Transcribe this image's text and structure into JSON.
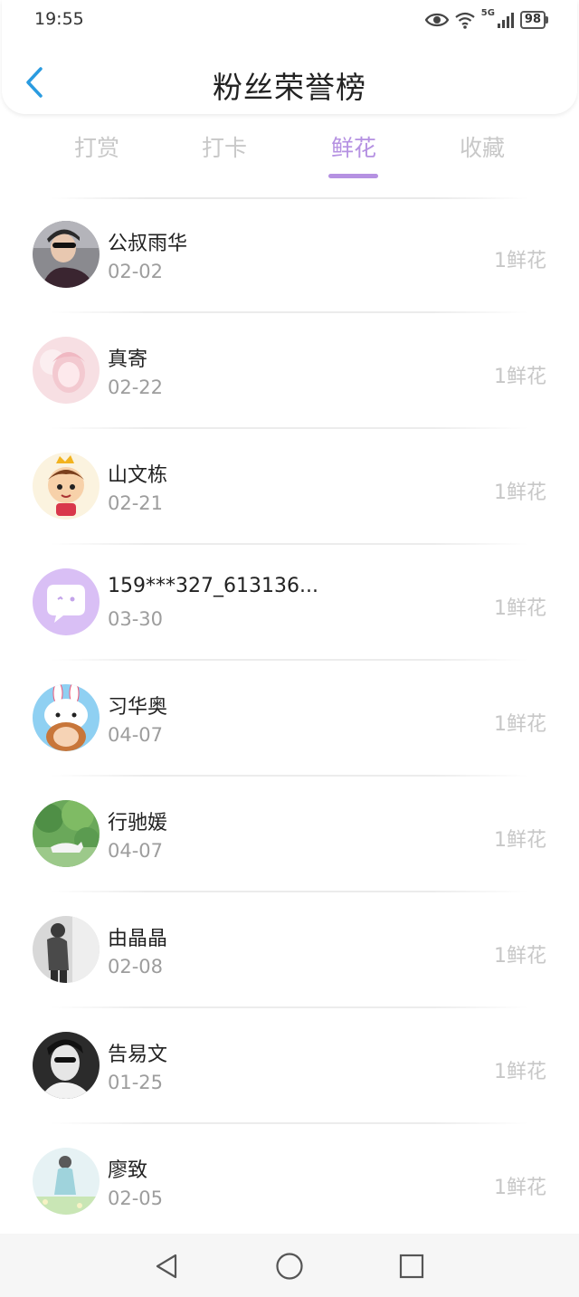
{
  "status_bar": {
    "time": "19:55",
    "network": "5G",
    "battery": "98",
    "icons": [
      "eye-icon",
      "wifi-icon",
      "signal-icon",
      "battery-icon"
    ]
  },
  "header": {
    "title": "粉丝荣誉榜",
    "back_icon": "chevron-left-icon"
  },
  "tabs": [
    {
      "label": "打赏",
      "active": false
    },
    {
      "label": "打卡",
      "active": false
    },
    {
      "label": "鲜花",
      "active": true
    },
    {
      "label": "收藏",
      "active": false
    }
  ],
  "accent_color": "#b591e2",
  "list": [
    {
      "name": "公叔雨华",
      "date": "02-02",
      "count": "1鲜花"
    },
    {
      "name": "真寄",
      "date": "02-22",
      "count": "1鲜花"
    },
    {
      "name": "山文栋",
      "date": "02-21",
      "count": "1鲜花"
    },
    {
      "name": "159***327_613136...",
      "date": "03-30",
      "count": "1鲜花"
    },
    {
      "name": "习华奥",
      "date": "04-07",
      "count": "1鲜花"
    },
    {
      "name": "行驰媛",
      "date": "04-07",
      "count": "1鲜花"
    },
    {
      "name": "由晶晶",
      "date": "02-08",
      "count": "1鲜花"
    },
    {
      "name": "告易文",
      "date": "01-25",
      "count": "1鲜花"
    },
    {
      "name": "廖致",
      "date": "02-05",
      "count": "1鲜花"
    }
  ],
  "nav_bar": {
    "icons": [
      "back-triangle-icon",
      "home-circle-icon",
      "recents-square-icon"
    ]
  }
}
